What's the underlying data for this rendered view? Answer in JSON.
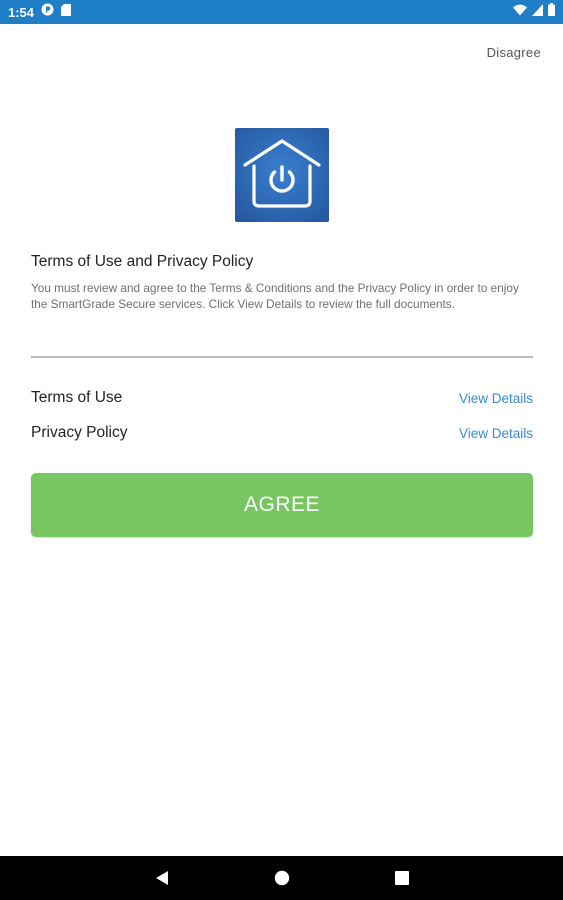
{
  "status_bar": {
    "time": "1:54",
    "background": "#1e7ec8",
    "left_icons": [
      "pocket-casts-icon",
      "sd-card-icon"
    ],
    "right_icons": [
      "wifi-icon",
      "signal-icon",
      "battery-icon"
    ]
  },
  "header": {
    "disagree_label": "Disagree"
  },
  "logo": {
    "icon": "smart-home-power-icon",
    "background": "#2c68b8"
  },
  "terms": {
    "title": "Terms of Use and Privacy Policy",
    "description": "You must review and agree to the Terms & Conditions and the Privacy Policy in order to enjoy the SmartGrade Secure services. Click View Details to review the full documents."
  },
  "documents": [
    {
      "label": "Terms of Use",
      "link": "View Details"
    },
    {
      "label": "Privacy Policy",
      "link": "View Details"
    }
  ],
  "agree": {
    "label": "AGREE",
    "color": "#78c661"
  },
  "nav_bar": {
    "icons": [
      "back-icon",
      "home-icon",
      "recents-icon"
    ]
  }
}
